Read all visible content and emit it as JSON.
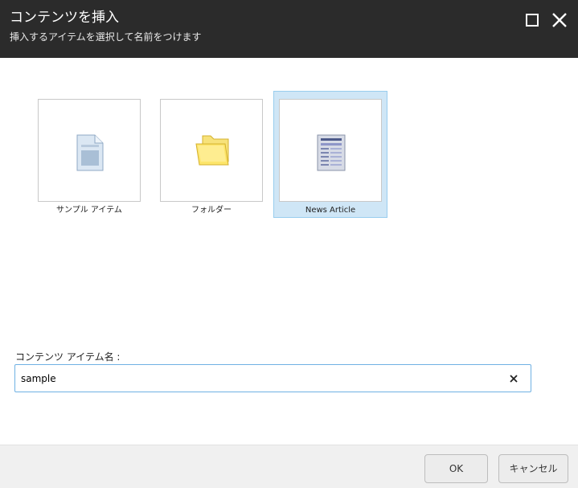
{
  "dialog": {
    "title": "コンテンツを挿入",
    "subtitle": "挿入するアイテムを選択して名前をつけます"
  },
  "templates": [
    {
      "label": "サンプル アイテム",
      "icon": "document-icon",
      "selected": false
    },
    {
      "label": "フォルダー",
      "icon": "folder-icon",
      "selected": false
    },
    {
      "label": "News Article",
      "icon": "news-article-icon",
      "selected": true
    }
  ],
  "name_field": {
    "label": "コンテンツ アイテム名 :",
    "value": "sample"
  },
  "buttons": {
    "ok": "OK",
    "cancel": "キャンセル"
  },
  "colors": {
    "header_bg": "#2b2b2b",
    "selection_bg": "#cfe6f6",
    "selection_border": "#99cdee",
    "input_border": "#6fb1e3"
  }
}
